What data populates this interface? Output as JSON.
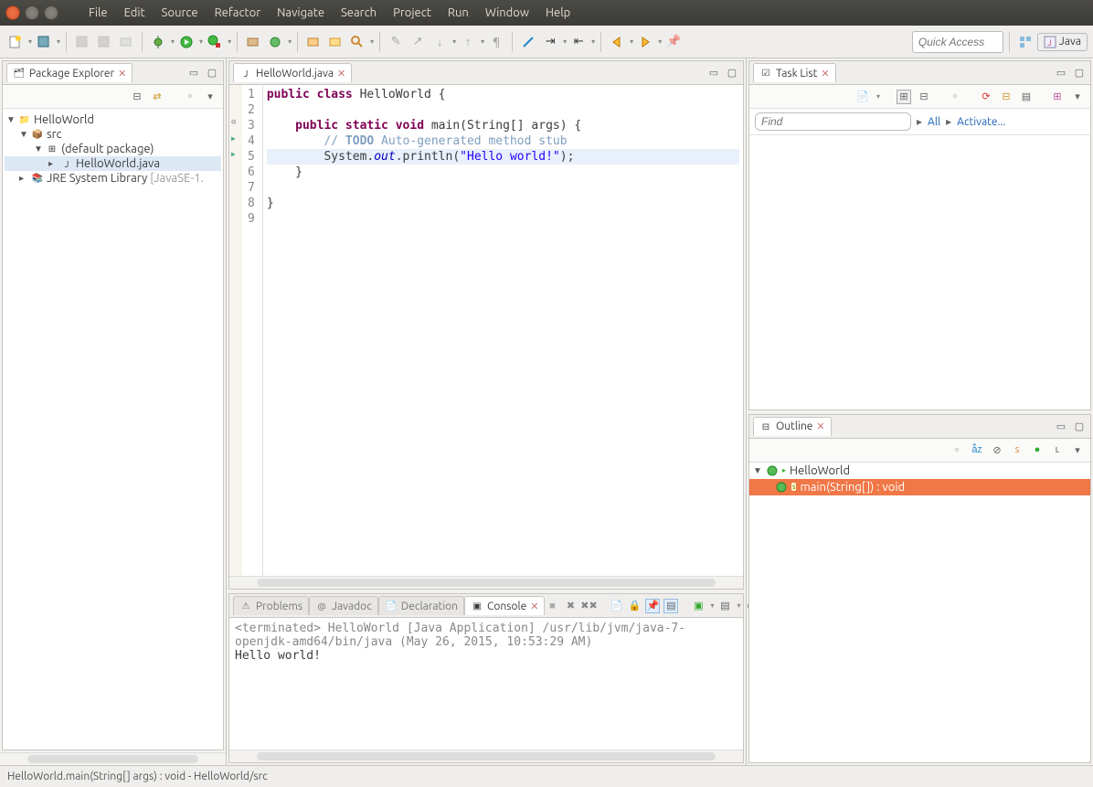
{
  "menus": [
    "File",
    "Edit",
    "Source",
    "Refactor",
    "Navigate",
    "Search",
    "Project",
    "Run",
    "Window",
    "Help"
  ],
  "quick_access_placeholder": "Quick Access",
  "perspective_label": "Java",
  "package_explorer": {
    "title": "Package Explorer",
    "project": "HelloWorld",
    "src": "src",
    "pkg": "(default package)",
    "file": "HelloWorld.java",
    "jre": "JRE System Library",
    "jre_profile": "[JavaSE-1."
  },
  "editor": {
    "tab": "HelloWorld.java",
    "lines": {
      "l1a": "public class",
      "l1b": " HelloWorld {",
      "l3a": "    public static void",
      "l3b": " main(String[] args) {",
      "l4a": "        // ",
      "l4b": "TODO",
      "l4c": " Auto-generated method stub",
      "l5a": "        System.",
      "l5b": "out",
      "l5c": ".println(",
      "l5d": "\"Hello world!\"",
      "l5e": ");",
      "l6": "    }",
      "l8": "}"
    }
  },
  "task_list": {
    "title": "Task List",
    "find_placeholder": "Find",
    "all": "All",
    "activate": "Activate..."
  },
  "outline": {
    "title": "Outline",
    "class": "HelloWorld",
    "method": "main(String[]) : void"
  },
  "bottom_tabs": {
    "problems": "Problems",
    "javadoc": "Javadoc",
    "declaration": "Declaration",
    "console": "Console"
  },
  "console": {
    "meta": "<terminated> HelloWorld [Java Application] /usr/lib/jvm/java-7-openjdk-amd64/bin/java (May 26, 2015, 10:53:29 AM)",
    "output": "Hello world!"
  },
  "status": "HelloWorld.main(String[] args) : void - HelloWorld/src"
}
